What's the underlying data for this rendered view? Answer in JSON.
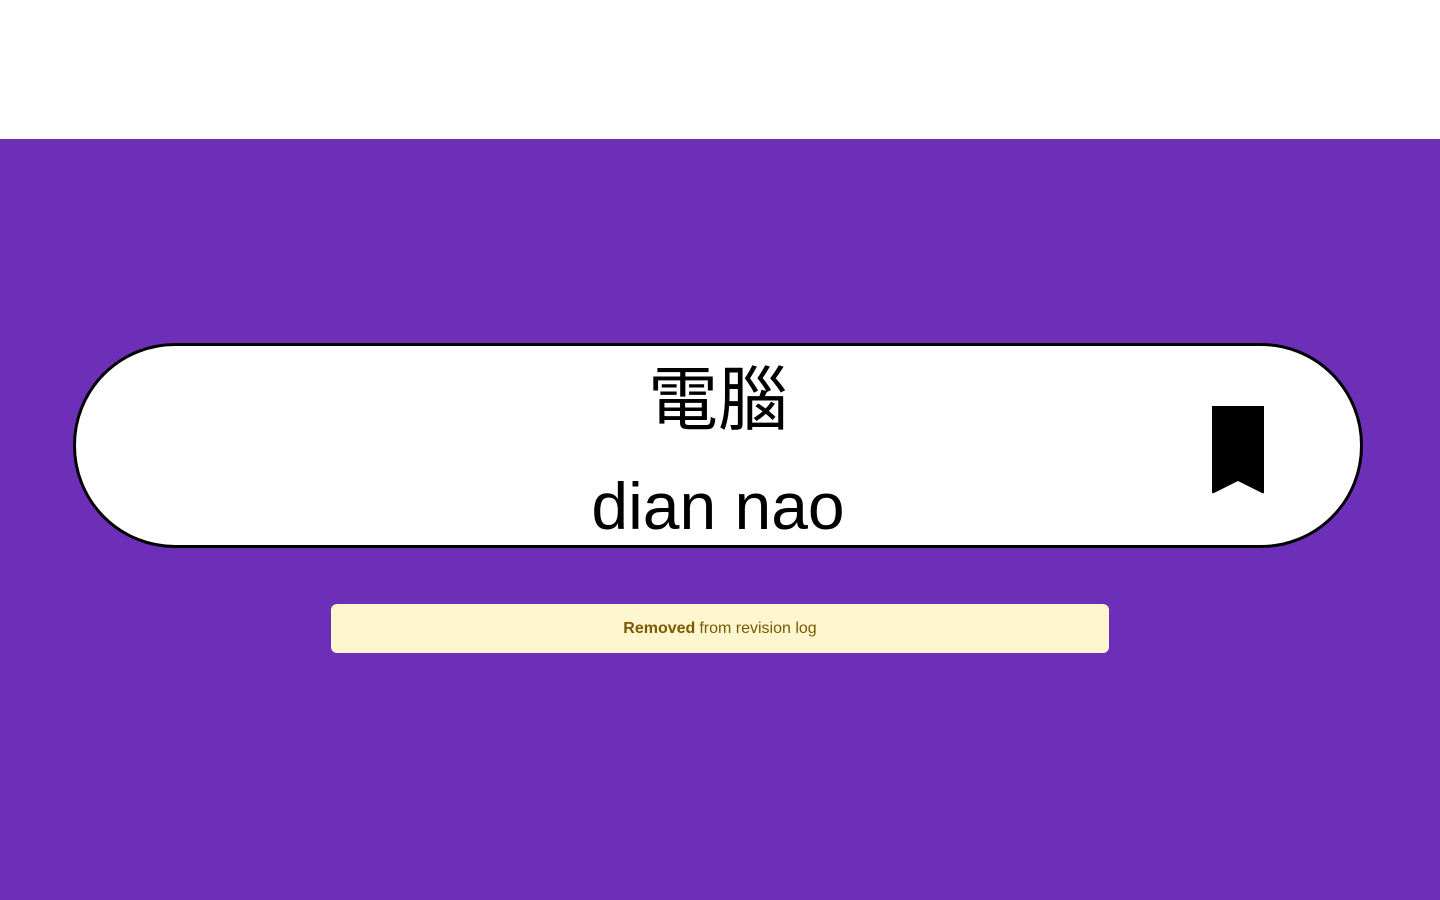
{
  "card": {
    "hanzi": "電腦",
    "pinyin": "dian nao",
    "bookmark_icon": "bookmark-icon"
  },
  "toast": {
    "strong": "Removed",
    "text": "from revision log"
  },
  "colors": {
    "background": "#6d2fb8",
    "card": "#ffffff",
    "toast_bg": "#fdf6cf",
    "toast_text": "#7a5a00"
  }
}
